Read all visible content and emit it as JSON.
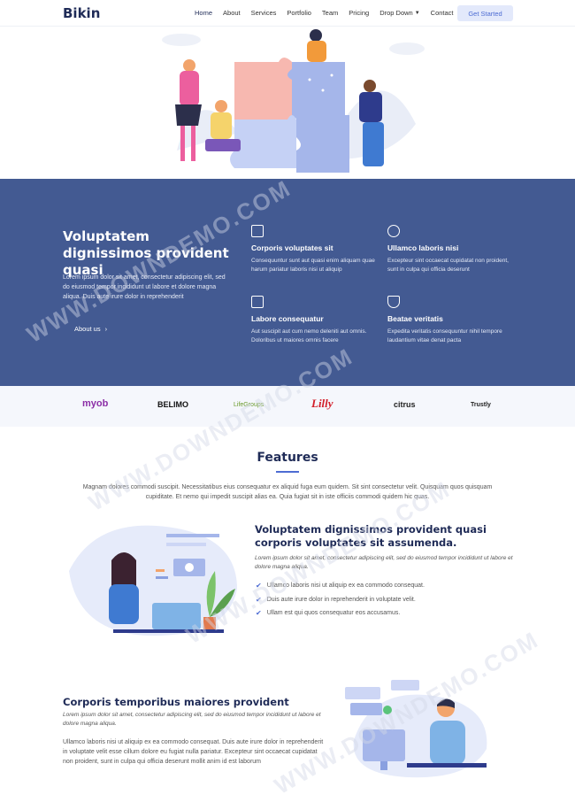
{
  "header": {
    "logo": "Bikin",
    "nav": [
      {
        "label": "Home"
      },
      {
        "label": "About"
      },
      {
        "label": "Services"
      },
      {
        "label": "Portfolio"
      },
      {
        "label": "Team"
      },
      {
        "label": "Pricing"
      },
      {
        "label": "Drop Down"
      },
      {
        "label": "Contact"
      }
    ],
    "cta_label": "Get Started"
  },
  "about": {
    "title": "Voluptatem dignissimos provident quasi",
    "text": "Lorem ipsum dolor sit amet, consectetur adipiscing elit, sed do eiusmod tempor incididunt ut labore et dolore magna aliqua. Duis aute irure dolor in reprehenderit",
    "button_label": "About us",
    "features": [
      {
        "icon": "document-icon",
        "title": "Corporis voluptates sit",
        "text": "Consequuntur sunt aut quasi enim aliquam quae harum pariatur laboris nisi ut aliquip"
      },
      {
        "icon": "cube-icon",
        "title": "Ullamco laboris nisi",
        "text": "Excepteur sint occaecat cupidatat non proident, sunt in culpa qui officia deserunt"
      },
      {
        "icon": "image-icon",
        "title": "Labore consequatur",
        "text": "Aut suscipit aut cum nemo deleniti aut omnis. Doloribus ut maiores omnis facere"
      },
      {
        "icon": "shield-icon",
        "title": "Beatae veritatis",
        "text": "Expedita veritatis consequuntur nihil tempore laudantium vitae denat pacta"
      }
    ]
  },
  "clients": [
    "myob",
    "BELIMO",
    "LifeGroups",
    "Lilly",
    "citrus",
    "Trustly"
  ],
  "features_section": {
    "title": "Features",
    "intro": "Magnam dolores commodi suscipit. Necessitatibus eius consequatur ex aliquid fuga eum quidem. Sit sint consectetur velit. Quisquam quos quisquam cupiditate. Et nemo qui impedit suscipit alias ea. Quia fugiat sit in iste officiis commodi quidem hic quas.",
    "item1": {
      "title": "Voluptatem dignissimos provident quasi corporis voluptates sit assumenda.",
      "italic": "Lorem ipsum dolor sit amet, consectetur adipiscing elit, sed do eiusmod tempor incididunt ut labore et dolore magna aliqua.",
      "bullets": [
        "Ullamco laboris nisi ut aliquip ex ea commodo consequat.",
        "Duis aute irure dolor in reprehenderit in voluptate velit.",
        "Ullam est qui quos consequatur eos accusamus."
      ]
    },
    "item2": {
      "title": "Corporis temporibus maiores provident",
      "italic": "Lorem ipsum dolor sit amet, consectetur adipiscing elit, sed do eiusmod tempor incididunt ut labore et dolore magna aliqua.",
      "text": "Ullamco laboris nisi ut aliquip ex ea commodo consequat. Duis aute irure dolor in reprehenderit in voluptate velit esse cillum dolore eu fugiat nulla pariatur. Excepteur sint occaecat cupidatat non proident, sunt in culpa qui officia deserunt mollit anim id est laborum"
    }
  },
  "watermark": "WWW.DOWNDEMO.COM",
  "colors": {
    "primary": "#435a92",
    "accent": "#4d6cd3",
    "heading": "#1f2b57"
  }
}
